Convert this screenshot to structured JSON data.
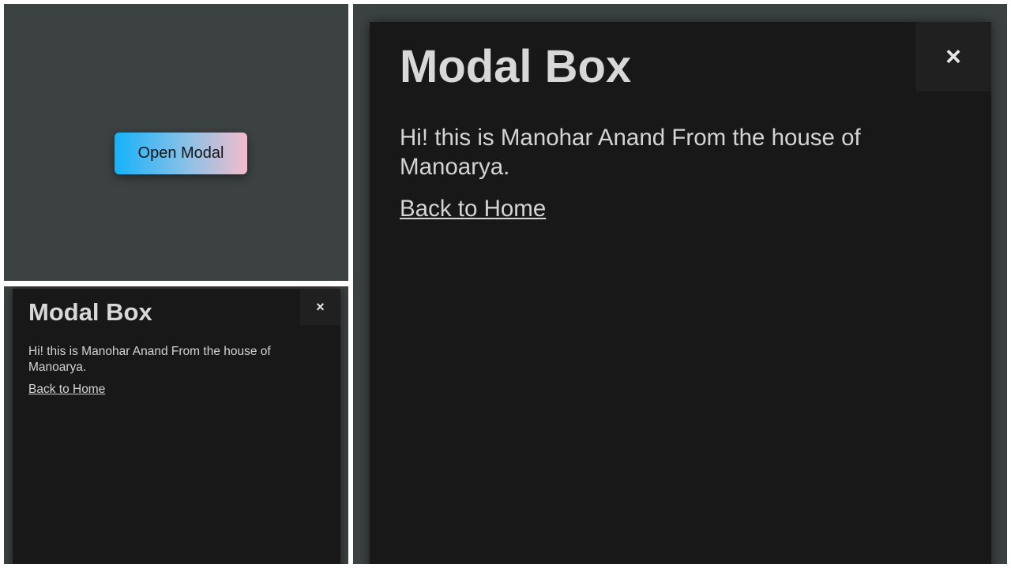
{
  "home_view": {
    "open_button_label": "Open Modal"
  },
  "modal": {
    "title": "Modal Box",
    "close_icon": "×",
    "message": "Hi! this is Manohar Anand From the house of Manoarya.",
    "link_label": "Back to Home"
  },
  "colors": {
    "panel_background": "#3c4242",
    "modal_background": "#181818",
    "close_button_background": "#202020",
    "button_gradient_start": "#16b2fa",
    "button_gradient_end": "#f2bccb",
    "text": "#d9d9d9"
  },
  "icons": {
    "close": "close-icon"
  }
}
